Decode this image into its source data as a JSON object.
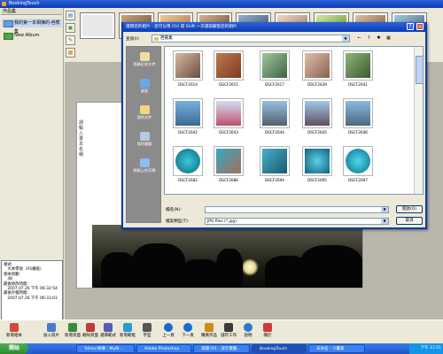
{
  "app": {
    "title": "BookingTouch"
  },
  "left_panel": {
    "header": "作品集",
    "albums": [
      {
        "label": "我的第一本相簿的-芭蕉集"
      },
      {
        "label": "New Album"
      }
    ],
    "info_lines": [
      "樣式:",
      "　大本零張（A5橫版）",
      "相本頁數:",
      "　48",
      "最後修改時間:",
      "　2007.07.26 下午 06:32:54",
      "最後存檔時間:",
      "　2007.07.26 下午 06:33:01"
    ]
  },
  "canvas": {
    "vertical_text": "請輸入書本名稱"
  },
  "dialog": {
    "title": "選擇您的相片 - 您可以用 Ctrl 或 Shift 一次選取數張您的相片",
    "look_in_label": "查詢(I):",
    "look_in_value": "芭蕉集",
    "places": [
      {
        "label": "我最近的文件",
        "icon": "recent-icon",
        "color": "#f0e0a0"
      },
      {
        "label": "桌面",
        "icon": "desktop-icon",
        "color": "#6aa8e8"
      },
      {
        "label": "我的文件",
        "icon": "documents-icon",
        "color": "#f3d77a"
      },
      {
        "label": "我的電腦",
        "icon": "computer-icon",
        "color": "#b8c8e0"
      },
      {
        "label": "網路上的芳鄰",
        "icon": "network-icon",
        "color": "#8cbcf0"
      }
    ],
    "files": [
      {
        "name": "DSCF2614"
      },
      {
        "name": "DSCF2615"
      },
      {
        "name": "DSCF2617"
      },
      {
        "name": "DSCF2639"
      },
      {
        "name": "DSCF2641"
      },
      {
        "name": "DSCF2642"
      },
      {
        "name": "DSCF2643"
      },
      {
        "name": "DSCF2644"
      },
      {
        "name": "DSCF2645"
      },
      {
        "name": "DSCF2646"
      },
      {
        "name": "DSCF2682"
      },
      {
        "name": "DSCF2686"
      },
      {
        "name": "DSCF2694"
      },
      {
        "name": "DSCF2695"
      },
      {
        "name": "DSCF2697"
      }
    ],
    "filename_label": "檔名(N):",
    "filename_value": "",
    "filetype_label": "檔案類型(T):",
    "filetype_value": "JPG files (*.jpg)",
    "open_label": "開啟(O)",
    "cancel_label": "取消"
  },
  "toolbar": {
    "items": [
      {
        "label": "新增相本",
        "color": "#d04a3a"
      },
      {
        "label": "加入照片",
        "color": "#4a7ad0"
      },
      {
        "label": "新增頁面",
        "color": "#3a8a3a"
      },
      {
        "label": "刪除頁面",
        "color": "#c03a3a"
      },
      {
        "label": "選擇範式",
        "color": "#5a5ab0"
      },
      {
        "label": "新增範框",
        "color": "#2a9ad0"
      },
      {
        "label": "字型",
        "color": "#555555"
      },
      {
        "label": "上一頁",
        "color": "#1a6ad0"
      },
      {
        "label": "下一頁",
        "color": "#1a6ad0"
      },
      {
        "label": "購買作品",
        "color": "#d08a1a"
      },
      {
        "label": "儲存工作",
        "color": "#3a3a3a"
      },
      {
        "label": "說明",
        "color": "#2a7ad0"
      },
      {
        "label": "關於",
        "color": "#d03a3a"
      }
    ]
  },
  "taskbar": {
    "start": "開始",
    "tasks": [
      {
        "label": "Yahoo!奇摩 - MyBl..."
      },
      {
        "label": "Adobe Photoshop"
      },
      {
        "label": "演講 [01 - 放在電腦..."
      },
      {
        "label": "BookingTouch"
      },
      {
        "label": "未命名 - 小畫家"
      }
    ],
    "clock": "下午 11:51"
  }
}
